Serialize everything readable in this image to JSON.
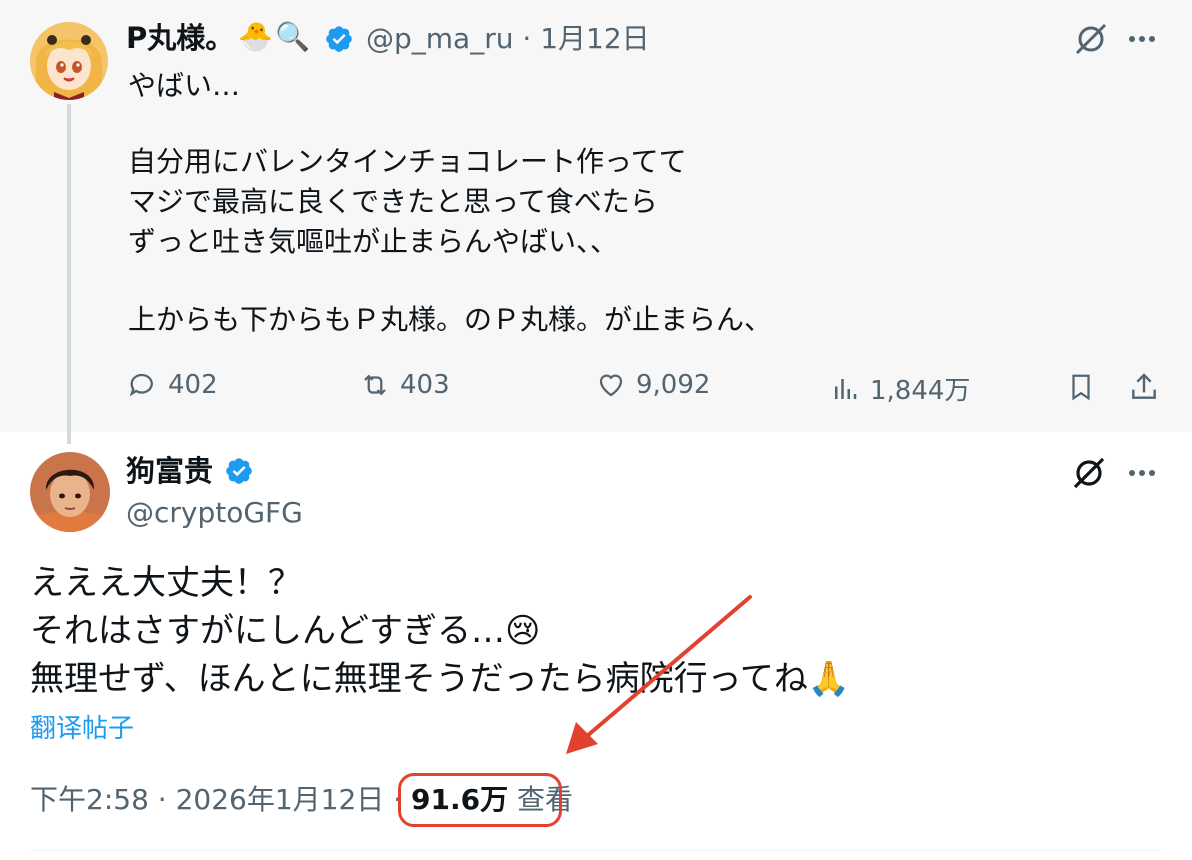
{
  "parent": {
    "display_name": "P丸様。",
    "name_emoji": [
      "🐣",
      "🔍"
    ],
    "handle": "@p_ma_ru",
    "separator": "·",
    "date": "1月12日",
    "lines": [
      "やばい…",
      "",
      "自分用にバレンタインチョコレート作ってて",
      "マジで最高に良くできたと思って食べたら",
      "ずっと吐き気嘔吐が止まらんやばい、、",
      "",
      "上からも下からもＰ丸様。のＰ丸様。が止まらん、"
    ],
    "stats": {
      "replies": "402",
      "retweets": "403",
      "likes": "9,092",
      "views": "1,844万"
    }
  },
  "reply": {
    "display_name": "狗富贵",
    "handle": "@cryptoGFG",
    "lines": [
      "えええ大丈夫！？",
      "それはさすがにしんどすぎる…",
      "無理せず、ほんとに無理そうだったら病院行ってね"
    ],
    "line_emoji": [
      "😢",
      "🙏"
    ],
    "translate": "翻译帖子",
    "time": "下午2:58",
    "dot": "·",
    "date": "2026年1月12日",
    "dot2": "·",
    "view_count": "91.6万",
    "view_label": "查看"
  },
  "colors": {
    "verified": "#1d9bf0",
    "annotation": "#e3412f",
    "link": "#1d9bf0"
  },
  "icons": [
    "grok-icon",
    "more-icon",
    "reply-icon",
    "retweet-icon",
    "like-icon",
    "views-icon",
    "bookmark-icon",
    "share-icon",
    "verified-icon",
    "annotation-arrow"
  ]
}
